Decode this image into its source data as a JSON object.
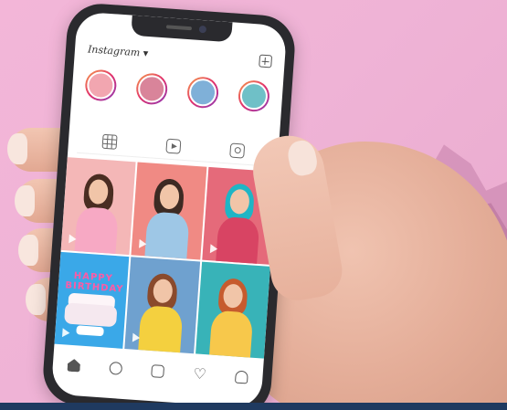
{
  "app": {
    "name": "Instagram"
  },
  "profile_header": {
    "logo_text": "Instagram",
    "dropdown_icon": "chevron-down-icon",
    "new_post_icon": "plus-square-icon"
  },
  "stories": [
    {
      "avatar_color": "#f2a6b0"
    },
    {
      "avatar_color": "#d9849a"
    },
    {
      "avatar_color": "#7fb0d8"
    },
    {
      "avatar_color": "#6fc0c7"
    }
  ],
  "tabs": [
    {
      "icon": "grid-icon"
    },
    {
      "icon": "reels-icon"
    },
    {
      "icon": "tagged-icon"
    }
  ],
  "posts": [
    {
      "bg": "#f4b7b7",
      "hair": "#4a2d22",
      "body": "#f7a9c4",
      "has_play": true
    },
    {
      "bg": "#f08a84",
      "hair": "#3d2a23",
      "body": "#9ec7e6",
      "has_play": true
    },
    {
      "bg": "#e56a7a",
      "hair": "#1fb5c5",
      "body": "#d84463",
      "has_play": true
    },
    {
      "bg": "#3aa8e8",
      "cake_text": "HAPPY BIRTHDAY",
      "has_play": true
    },
    {
      "bg": "#6fa1cf",
      "hair": "#8a4a2c",
      "body": "#f4d03f",
      "has_play": true
    },
    {
      "bg": "#38b3b8",
      "hair": "#c65b2e",
      "body": "#f7c84b",
      "has_play": false
    }
  ],
  "bottom_nav": [
    {
      "icon": "home-icon"
    },
    {
      "icon": "search-icon"
    },
    {
      "icon": "reels-icon"
    },
    {
      "icon": "heart-icon"
    },
    {
      "icon": "profile-icon"
    }
  ],
  "colors": {
    "background": "#efb3d6",
    "phone_frame": "#2a2a2e",
    "footer_bar": "#1f3a60"
  }
}
